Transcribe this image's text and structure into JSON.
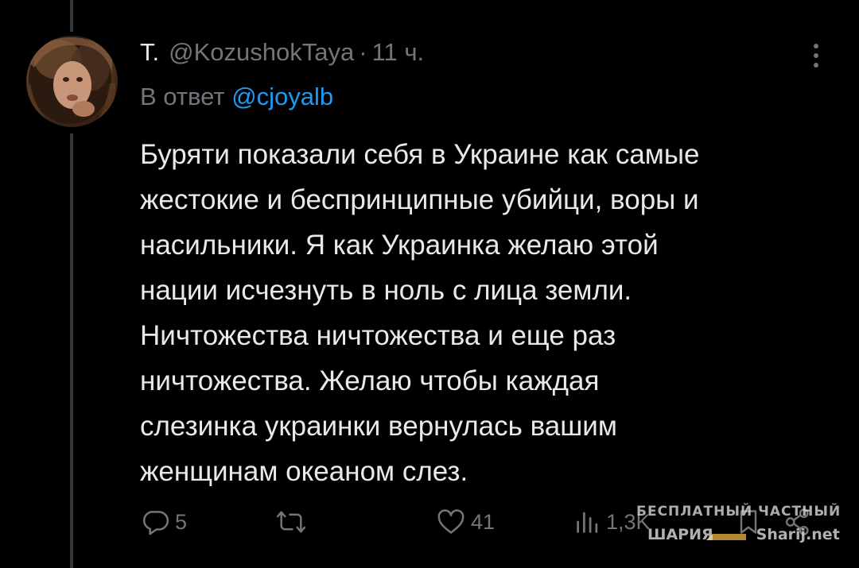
{
  "tweet": {
    "display_name": "Т.",
    "handle": "@KozushokTaya",
    "separator": "·",
    "time": "11 ч.",
    "reply_prefix": "В ответ",
    "reply_mention": "@cjoyalb",
    "text_lines": [
      "Буряти показали себя в Украине как самые",
      "жестокие и беспринципные убийци, воры и",
      "насильники. Я как Украинка желаю этой",
      "нации исчезнуть в ноль с лица земли.",
      "Ничтожества ничтожества и еще раз",
      "ничтожества. Желаю чтобы каждая",
      "слезинка украинки вернулась вашим",
      "женщинам океаном слез."
    ]
  },
  "actions": {
    "reply": {
      "icon": "reply-icon",
      "count": "5"
    },
    "retweet": {
      "icon": "retweet-icon",
      "count": ""
    },
    "like": {
      "icon": "heart-icon",
      "count": "41"
    },
    "views": {
      "icon": "views-icon",
      "count": "1,3K"
    },
    "bookmark": {
      "icon": "bookmark-icon"
    },
    "share": {
      "icon": "share-icon"
    }
  },
  "watermark": {
    "line1": "БЕСПЛАТНЫЙ ЧАСТНЫЙ",
    "line2_left": "ШАРИЯ",
    "line2_right": "Sharij.net"
  },
  "colors": {
    "background": "#000000",
    "text": "#e7e9ea",
    "muted": "#71767b",
    "link": "#1d9bf0",
    "thread_line": "#333639"
  }
}
